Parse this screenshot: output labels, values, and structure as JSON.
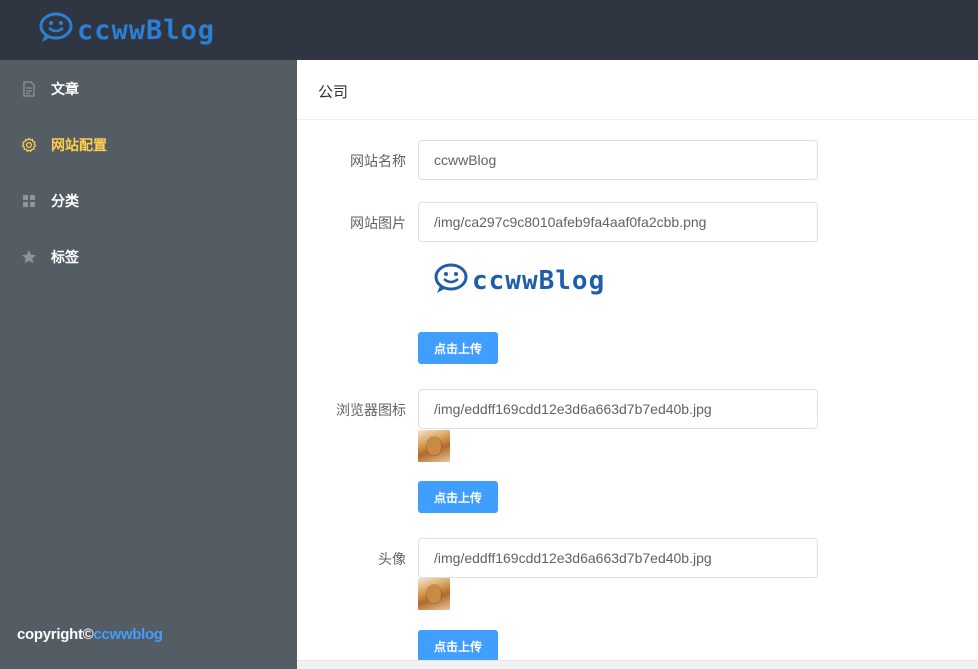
{
  "header": {
    "logo_text": "ccwwBlog"
  },
  "sidebar": {
    "items": [
      {
        "label": "文章",
        "icon": "document-icon",
        "active": false
      },
      {
        "label": "网站配置",
        "icon": "gear-icon",
        "active": true
      },
      {
        "label": "分类",
        "icon": "grid-icon",
        "active": false
      },
      {
        "label": "标签",
        "icon": "star-icon",
        "active": false
      }
    ],
    "copyright_prefix": "copyright©",
    "copyright_brand": "ccwwblog"
  },
  "main": {
    "title": "公司",
    "fields": [
      {
        "label": "网站名称",
        "value": "ccwwBlog"
      },
      {
        "label": "网站图片",
        "value": "/img/ca297c9c8010afeb9fa4aaf0fa2cbb.png"
      },
      {
        "label": "浏览器图标",
        "value": "/img/eddff169cdd12e3d6a663d7b7ed40b.jpg"
      },
      {
        "label": "头像",
        "value": "/img/eddff169cdd12e3d6a663d7b7ed40b.jpg"
      }
    ],
    "preview_logo_text": "ccwwBlog",
    "upload_label": "点击上传"
  },
  "colors": {
    "header_bg": "#303641",
    "sidebar_bg": "#545c64",
    "active_text": "#ffd04b",
    "primary": "#409eff",
    "logo_blue": "#2b7fd4"
  }
}
